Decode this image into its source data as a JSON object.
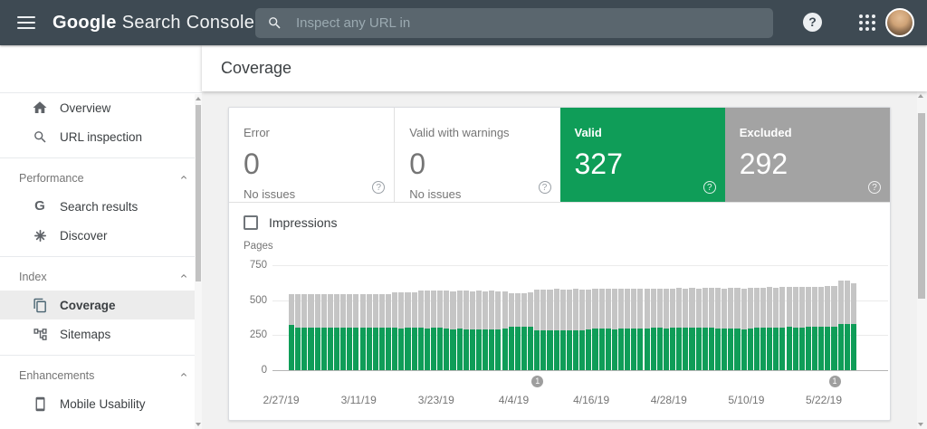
{
  "topbar": {
    "logo": {
      "google": "Google",
      "rest": "Search Console"
    },
    "search": {
      "placeholder": "Inspect any URL in",
      "value": ""
    },
    "help_glyph": "?"
  },
  "page": {
    "title": "Coverage"
  },
  "sidebar": {
    "items": [
      {
        "label": "Overview",
        "icon": "home",
        "selected": false
      },
      {
        "label": "URL inspection",
        "icon": "search",
        "selected": false
      }
    ],
    "sections": [
      {
        "label": "Performance",
        "items": [
          {
            "label": "Search results",
            "icon": "g-logo",
            "selected": false
          },
          {
            "label": "Discover",
            "icon": "discover",
            "selected": false
          }
        ]
      },
      {
        "label": "Index",
        "items": [
          {
            "label": "Coverage",
            "icon": "coverage",
            "selected": true
          },
          {
            "label": "Sitemaps",
            "icon": "sitemaps",
            "selected": false
          }
        ]
      },
      {
        "label": "Enhancements",
        "items": [
          {
            "label": "Mobile Usability",
            "icon": "mobile",
            "selected": false
          }
        ]
      }
    ]
  },
  "summary_cards": [
    {
      "label": "Error",
      "value": "0",
      "sub": "No issues",
      "style": "white",
      "help_glyph": "?"
    },
    {
      "label": "Valid with warnings",
      "value": "0",
      "sub": "No issues",
      "style": "white",
      "help_glyph": "?"
    },
    {
      "label": "Valid",
      "value": "327",
      "sub": "",
      "style": "green",
      "help_glyph": "?"
    },
    {
      "label": "Excluded",
      "value": "292",
      "sub": "",
      "style": "gray",
      "help_glyph": "?"
    }
  ],
  "controls": {
    "impressions_label": "Impressions",
    "impressions_checked": false
  },
  "colors": {
    "topbar": "#3e4a53",
    "valid_green": "#0f9d58",
    "excluded_card_gray": "#a3a3a3",
    "excluded_bar_gray": "#c5c5c5",
    "selected_icon": "#4a6572",
    "axis_text": "#757575"
  },
  "chart_data": {
    "type": "bar",
    "stacked": true,
    "title": "",
    "xlabel": "",
    "ylabel": "Pages",
    "ylim": [
      0,
      750
    ],
    "yticks": [
      0,
      250,
      500,
      750
    ],
    "grid": true,
    "legend": "none",
    "x_start_date": "2/27/19",
    "x_ticks": [
      {
        "label": "2/27/19",
        "day": 0
      },
      {
        "label": "3/11/19",
        "day": 12
      },
      {
        "label": "3/23/19",
        "day": 24
      },
      {
        "label": "4/4/19",
        "day": 36
      },
      {
        "label": "4/16/19",
        "day": 48
      },
      {
        "label": "4/28/19",
        "day": 60
      },
      {
        "label": "5/10/19",
        "day": 72
      },
      {
        "label": "5/22/19",
        "day": 84
      }
    ],
    "markers": [
      {
        "label": "1",
        "day": 38
      },
      {
        "label": "1",
        "day": 84
      }
    ],
    "series": [
      {
        "name": "Valid",
        "color": "#0f9d58",
        "values": [
          325,
          304,
          303,
          305,
          304,
          306,
          303,
          305,
          304,
          306,
          305,
          303,
          305,
          304,
          306,
          305,
          301,
          300,
          302,
          301,
          303,
          300,
          302,
          301,
          295,
          293,
          295,
          294,
          291,
          293,
          292,
          294,
          293,
          295,
          308,
          309,
          308,
          310,
          283,
          282,
          284,
          283,
          285,
          282,
          284,
          283,
          294,
          295,
          297,
          296,
          294,
          296,
          295,
          297,
          296,
          298,
          301,
          302,
          300,
          303,
          301,
          302,
          304,
          301,
          303,
          302,
          297,
          295,
          298,
          296,
          294,
          297,
          305,
          306,
          304,
          307,
          305,
          308,
          306,
          305,
          311,
          312,
          310,
          313,
          312,
          330,
          331,
          327
        ]
      },
      {
        "name": "Excluded",
        "color": "#c5c5c5",
        "values": [
          220,
          239,
          241,
          237,
          241,
          237,
          243,
          239,
          239,
          239,
          239,
          239,
          241,
          239,
          239,
          239,
          255,
          258,
          255,
          258,
          263,
          268,
          268,
          268,
          272,
          272,
          273,
          272,
          273,
          274,
          273,
          272,
          271,
          270,
          242,
          243,
          243,
          243,
          294,
          296,
          293,
          296,
          293,
          295,
          295,
          295,
          284,
          285,
          282,
          285,
          286,
          283,
          286,
          283,
          286,
          283,
          282,
          282,
          283,
          282,
          285,
          282,
          283,
          284,
          283,
          286,
          289,
          290,
          289,
          290,
          290,
          290,
          284,
          284,
          288,
          284,
          288,
          284,
          288,
          288,
          285,
          286,
          287,
          287,
          287,
          308,
          309,
          292
        ]
      }
    ]
  }
}
